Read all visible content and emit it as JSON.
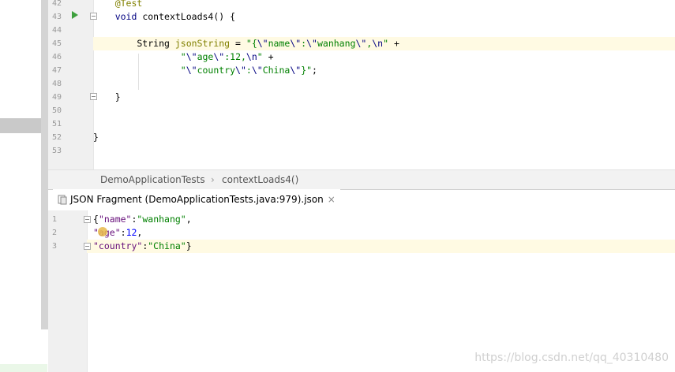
{
  "editor": {
    "lines": [
      {
        "n": "42",
        "parts": [
          {
            "t": "    ",
            "c": ""
          },
          {
            "t": "@Test",
            "c": "ann"
          }
        ]
      },
      {
        "n": "43",
        "parts": [
          {
            "t": "    ",
            "c": ""
          },
          {
            "t": "void",
            "c": "kw"
          },
          {
            "t": " contextLoads4() {",
            "c": ""
          }
        ]
      },
      {
        "n": "44",
        "parts": []
      },
      {
        "n": "45",
        "parts": [
          {
            "t": "        String ",
            "c": ""
          },
          {
            "t": "jsonString",
            "c": "var"
          },
          {
            "t": " = ",
            "c": ""
          },
          {
            "t": "\"{",
            "c": "str"
          },
          {
            "t": "\\\"",
            "c": "esc"
          },
          {
            "t": "name",
            "c": "str"
          },
          {
            "t": "\\\"",
            "c": "esc"
          },
          {
            "t": ":",
            "c": "str"
          },
          {
            "t": "\\\"",
            "c": "esc"
          },
          {
            "t": "wanhang",
            "c": "str"
          },
          {
            "t": "\\\"",
            "c": "esc"
          },
          {
            "t": ",",
            "c": "str"
          },
          {
            "t": "\\n",
            "c": "esc"
          },
          {
            "t": "\"",
            "c": "str"
          },
          {
            "t": " +",
            "c": ""
          }
        ]
      },
      {
        "n": "46",
        "parts": [
          {
            "t": "                ",
            "c": ""
          },
          {
            "t": "\"",
            "c": "str"
          },
          {
            "t": "\\\"",
            "c": "esc"
          },
          {
            "t": "age",
            "c": "str"
          },
          {
            "t": "\\\"",
            "c": "esc"
          },
          {
            "t": ":12,",
            "c": "str"
          },
          {
            "t": "\\n",
            "c": "esc"
          },
          {
            "t": "\"",
            "c": "str"
          },
          {
            "t": " +",
            "c": ""
          }
        ]
      },
      {
        "n": "47",
        "parts": [
          {
            "t": "                ",
            "c": ""
          },
          {
            "t": "\"",
            "c": "str"
          },
          {
            "t": "\\\"",
            "c": "esc"
          },
          {
            "t": "country",
            "c": "str"
          },
          {
            "t": "\\\"",
            "c": "esc"
          },
          {
            "t": ":",
            "c": "str"
          },
          {
            "t": "\\\"",
            "c": "esc"
          },
          {
            "t": "China",
            "c": "str"
          },
          {
            "t": "\\\"",
            "c": "esc"
          },
          {
            "t": "}\"",
            "c": "str"
          },
          {
            "t": ";",
            "c": ""
          }
        ]
      },
      {
        "n": "48",
        "parts": []
      },
      {
        "n": "49",
        "parts": [
          {
            "t": "    }",
            "c": ""
          }
        ]
      },
      {
        "n": "50",
        "parts": []
      },
      {
        "n": "51",
        "parts": []
      },
      {
        "n": "52",
        "parts": [
          {
            "t": "}",
            "c": ""
          }
        ]
      },
      {
        "n": "53",
        "parts": []
      }
    ]
  },
  "breadcrumb": {
    "class_name": "DemoApplicationTests",
    "separator": "›",
    "method_name": "contextLoads4()"
  },
  "tab": {
    "label": "JSON Fragment (DemoApplicationTests.java:979).json",
    "close": "×"
  },
  "json_editor": {
    "lines": [
      {
        "n": "1",
        "parts": [
          {
            "t": "{",
            "c": ""
          },
          {
            "t": "\"name\"",
            "c": "key"
          },
          {
            "t": ":",
            "c": ""
          },
          {
            "t": "\"wanhang\"",
            "c": "jstr"
          },
          {
            "t": ",",
            "c": ""
          }
        ]
      },
      {
        "n": "2",
        "parts": [
          {
            "t": "\"age\"",
            "c": "key"
          },
          {
            "t": ":",
            "c": ""
          },
          {
            "t": "12",
            "c": "jnum"
          },
          {
            "t": ",",
            "c": ""
          }
        ]
      },
      {
        "n": "3",
        "parts": [
          {
            "t": "\"country\"",
            "c": "key"
          },
          {
            "t": ":",
            "c": ""
          },
          {
            "t": "\"China\"",
            "c": "jstr"
          },
          {
            "t": "}",
            "c": ""
          }
        ]
      }
    ]
  },
  "watermark": "https://blog.csdn.net/qq_40310480"
}
